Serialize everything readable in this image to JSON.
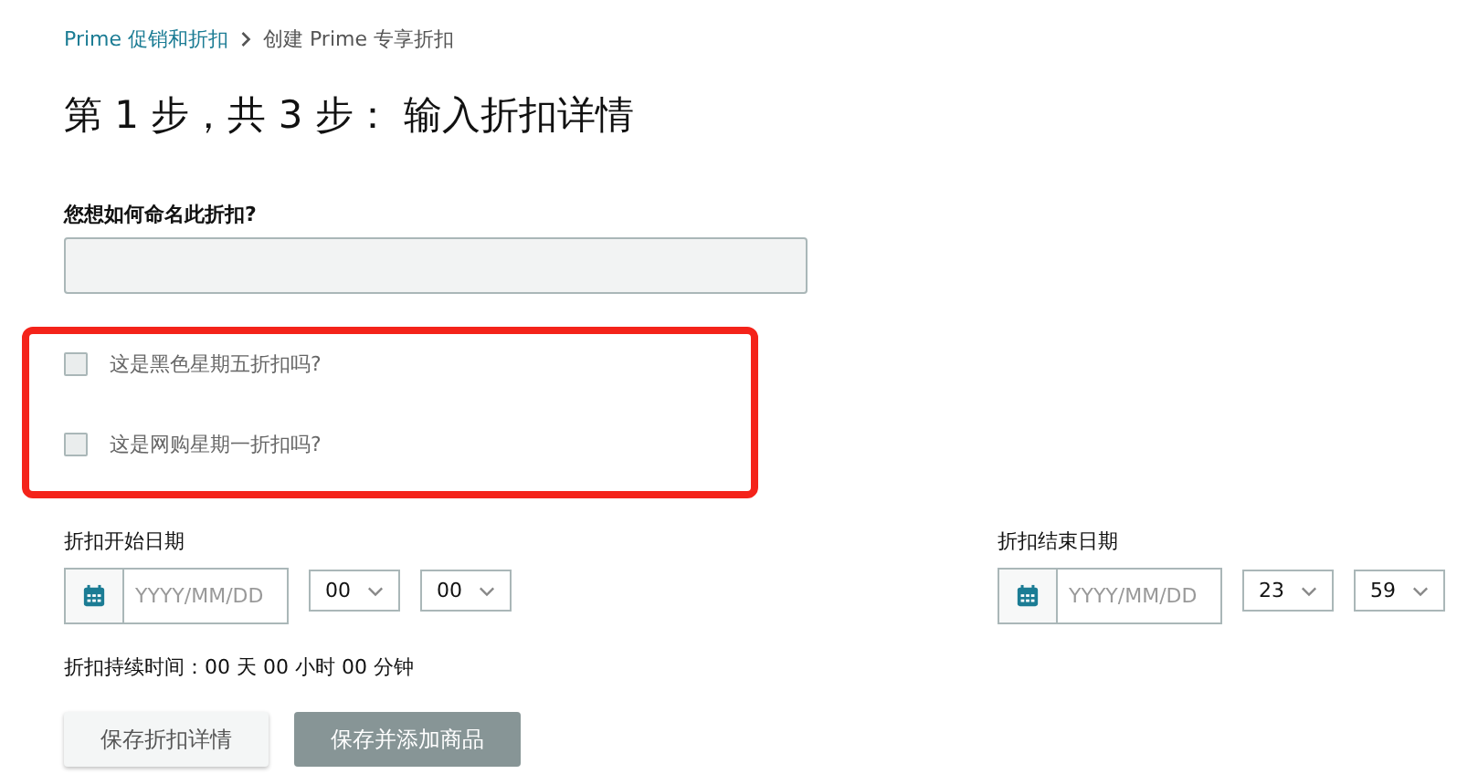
{
  "breadcrumb": [
    {
      "label": "Prime 促销和折扣",
      "link": true
    },
    {
      "label": "创建 Prime 专享折扣",
      "link": false
    }
  ],
  "title": "第 1 步，共 3 步： 输入折扣详情",
  "name_field": {
    "label": "您想如何命名此折扣?"
  },
  "options": {
    "highlighted": true,
    "items": [
      {
        "label": "这是黑色星期五折扣吗?",
        "checked": false
      },
      {
        "label": "这是网购星期一折扣吗?",
        "checked": false
      }
    ]
  },
  "dates": [
    {
      "label": "折扣开始日期",
      "placeholder": "YYYY/MM/DD",
      "hour": "00",
      "minute": "00"
    },
    {
      "label": "折扣结束日期",
      "placeholder": "YYYY/MM/DD",
      "hour": "23",
      "minute": "59"
    }
  ],
  "duration": "折扣持续时间：00 天 00 小时 00 分钟",
  "buttons": [
    {
      "label": "保存折扣详情",
      "kind": "secondary"
    },
    {
      "label": "保存并添加商品",
      "kind": "primary"
    }
  ]
}
